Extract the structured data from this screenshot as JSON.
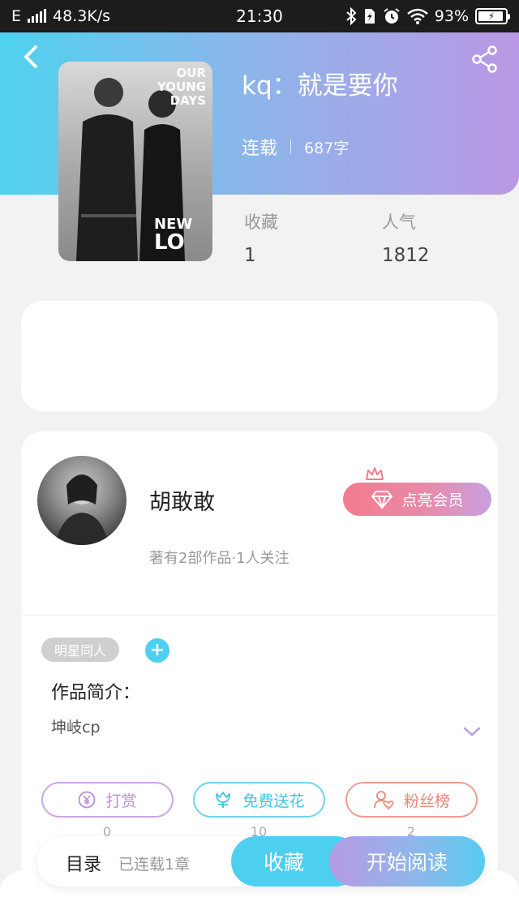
{
  "status_bar": {
    "network": "E",
    "speed": "48.3K/s",
    "time": "21:30",
    "battery": "93%",
    "battery_level": 0.93
  },
  "book": {
    "title": "kq：就是要你",
    "status": "连载",
    "word_count": "687字",
    "cover_top_text": [
      "OUR",
      "YOUNG",
      "DAYS"
    ],
    "cover_bottom_text": [
      "NEW",
      "LO"
    ],
    "stats": [
      {
        "label": "收藏",
        "value": "1"
      },
      {
        "label": "人气",
        "value": "1812"
      }
    ]
  },
  "author": {
    "name": "胡敢敢",
    "info": "著有2部作品·1人关注",
    "vip_label": "点亮会员"
  },
  "tag": "明星同人",
  "intro": {
    "label": "作品简介：",
    "text": "坤岐cp"
  },
  "actions": [
    {
      "label": "打赏",
      "count": "0",
      "icon": "yuan-coin-icon"
    },
    {
      "label": "免费送花",
      "count": "10",
      "icon": "flower-icon"
    },
    {
      "label": "粉丝榜",
      "count": "2",
      "icon": "fan-heart-icon"
    }
  ],
  "bottom": {
    "toc_label": "目录",
    "chapters": "已连载1章",
    "collect_label": "收藏",
    "read_label": "开始阅读"
  },
  "colors": {
    "accent_cyan": "#4dcff0",
    "accent_purple": "#b998e4",
    "vip_pink": "#f47b8e"
  }
}
